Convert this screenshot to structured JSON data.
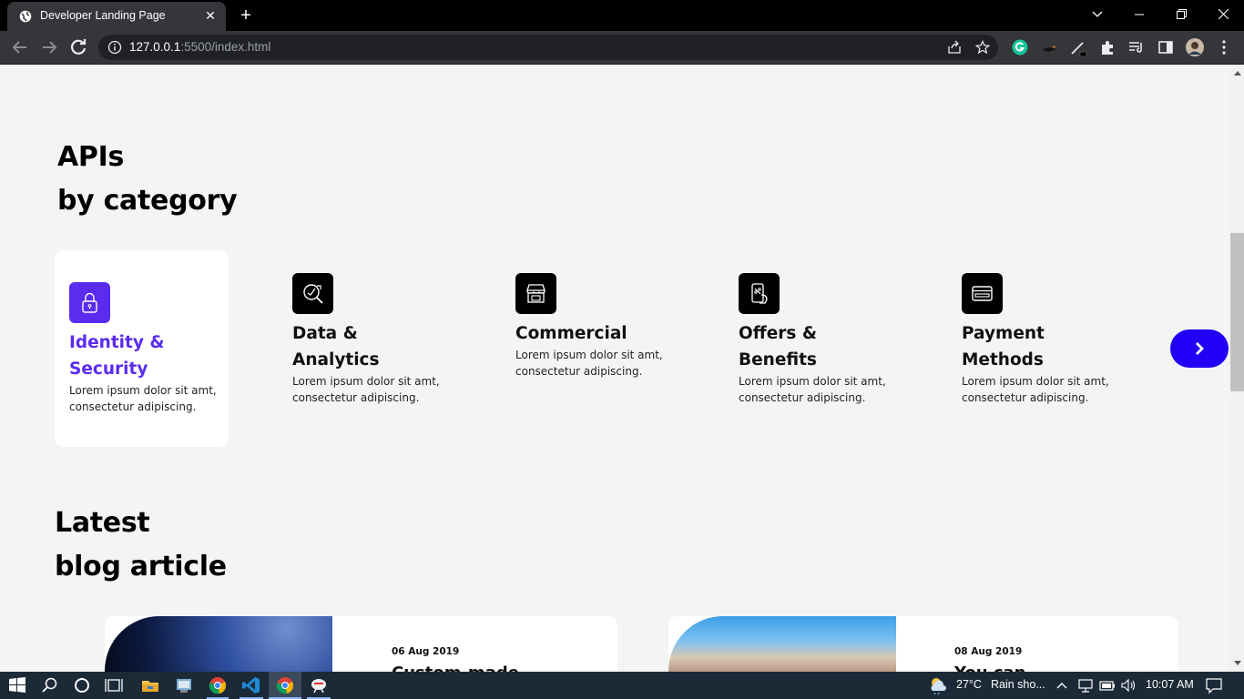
{
  "browser": {
    "tab_title": "Developer Landing Page",
    "url_host": "127.0.0.1",
    "url_rest": ":5500/index.html"
  },
  "page": {
    "apis_heading_line1": "APIs",
    "apis_heading_line2": "by category",
    "categories": [
      {
        "title": "Identity &\nSecurity",
        "desc": "Lorem ipsum dolor sit amt, consectetur adipiscing.",
        "icon": "lock-icon",
        "active": true
      },
      {
        "title": "Data &\nAnalytics",
        "desc": "Lorem ipsum dolor sit amt, consectetur adipiscing.",
        "icon": "analytics-icon"
      },
      {
        "title": "Commercial",
        "desc": "Lorem ipsum dolor sit amt, consectetur adipiscing.",
        "icon": "store-icon"
      },
      {
        "title": "Offers &\nBenefits",
        "desc": "Lorem ipsum dolor sit amt, consectetur adipiscing.",
        "icon": "offer-icon"
      },
      {
        "title": "Payment\nMethods",
        "desc": "Lorem ipsum dolor sit amt, consectetur adipiscing.",
        "icon": "card-icon"
      }
    ],
    "blog_heading_line1": "Latest",
    "blog_heading_line2": "blog article",
    "blog_cards": [
      {
        "date": "06 Aug 2019",
        "title": "Custom-made"
      },
      {
        "date": "08 Aug 2019",
        "title": "You can"
      }
    ]
  },
  "taskbar": {
    "weather_temp": "27°C",
    "weather_desc": "Rain sho...",
    "time": "10:07 AM"
  },
  "colors": {
    "accent": "#5b2bf0",
    "next_button": "#2200f5",
    "page_bg": "#f4f4f4"
  }
}
